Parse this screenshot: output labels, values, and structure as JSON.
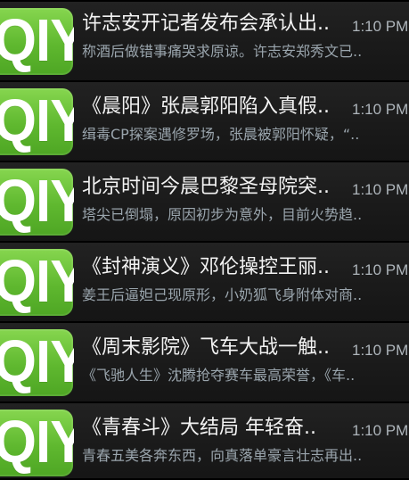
{
  "notifications": [
    {
      "logo_text": "QIY",
      "title": "许志安开记者发布会承认出..",
      "summary": "称酒后做错事痛哭求原谅。许志安郑秀文已..",
      "time": "1:10 PM"
    },
    {
      "logo_text": "QIY",
      "title": "《晨阳》张晨郭阳陷入真假..",
      "summary": "缉毒CP探案遇修罗场，张晨被郭阳怀疑，“..",
      "time": "1:10 PM"
    },
    {
      "logo_text": "QIY",
      "title": "北京时间今晨巴黎圣母院突..",
      "summary": "塔尖已倒塌，原因初步为意外，目前火势趋..",
      "time": "1:10 PM"
    },
    {
      "logo_text": "QIY",
      "title": "《封神演义》邓伦操控王丽..",
      "summary": "姜王后逼妲己现原形，小奶狐飞身附体对商..",
      "time": "1:10 PM"
    },
    {
      "logo_text": "QIY",
      "title": "《周末影院》飞车大战一触..",
      "summary": "《飞驰人生》沈腾抢夺赛车最高荣誉，《车..",
      "time": "1:10 PM"
    },
    {
      "logo_text": "QIY",
      "title": "《青春斗》大结局 年轻奋..",
      "summary": "青春五美各奔东西，向真落单豪言壮志再出..",
      "time": "1:10 PM"
    }
  ]
}
